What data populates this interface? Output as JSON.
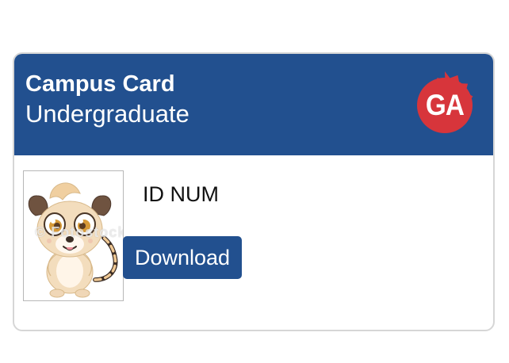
{
  "card": {
    "title": "Campus Card",
    "subtitle": "Undergraduate",
    "logo_text": "GA",
    "id_label": "ID NUM",
    "download_label": "Download",
    "photo_watermark": "© Fotostock"
  },
  "colors": {
    "header_blue": "#22508f",
    "logo_red": "#d7353b",
    "button_blue": "#22508f"
  },
  "icons": {
    "logo": "ga-seal-icon",
    "photo": "cartoon-cat-photo"
  }
}
